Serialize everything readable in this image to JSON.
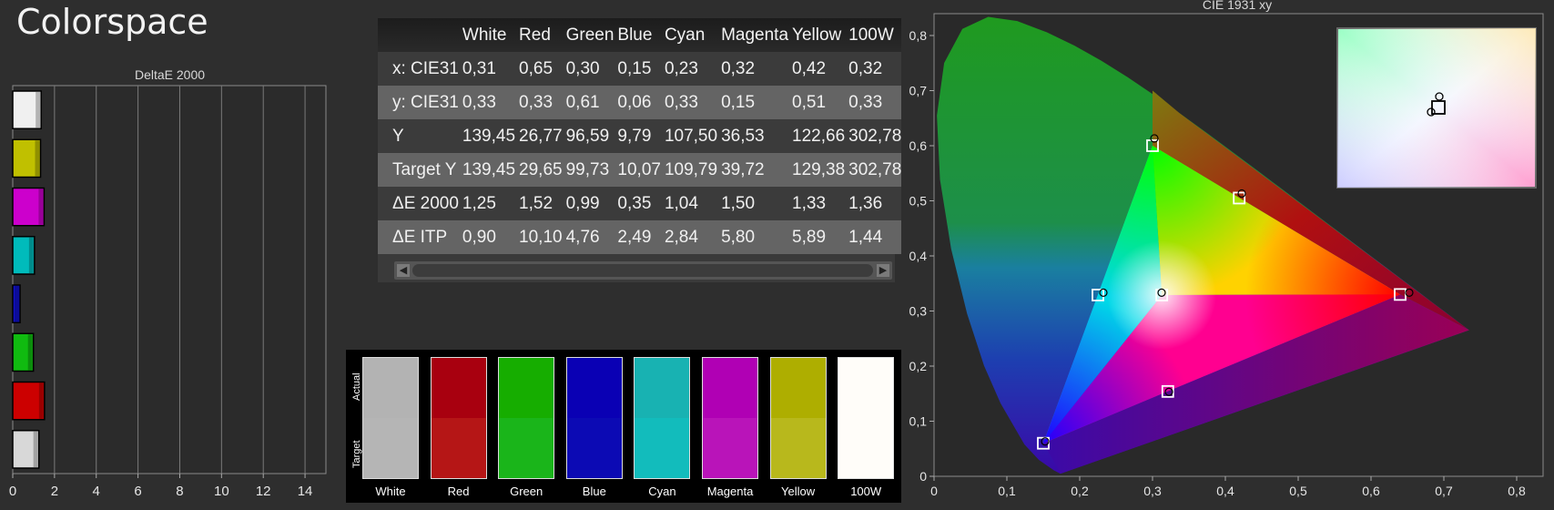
{
  "page": {
    "title": "Colorspace"
  },
  "delta_chart": {
    "title": "DeltaE 2000",
    "x_ticks": [
      "0",
      "2",
      "4",
      "6",
      "8",
      "10",
      "12",
      "14"
    ],
    "bars": [
      {
        "name": "White",
        "value": 1.36,
        "color": "#f0f0f0"
      },
      {
        "name": "Yellow",
        "value": 1.33,
        "color": "#c0c000"
      },
      {
        "name": "Magenta",
        "value": 1.5,
        "color": "#cc00cc"
      },
      {
        "name": "Cyan",
        "value": 1.04,
        "color": "#00bbbb"
      },
      {
        "name": "Blue",
        "value": 0.35,
        "color": "#1010cc"
      },
      {
        "name": "Green",
        "value": 0.99,
        "color": "#10bb10"
      },
      {
        "name": "Red",
        "value": 1.52,
        "color": "#cc0000"
      },
      {
        "name": "White",
        "value": 1.25,
        "color": "#d8d8d8"
      }
    ]
  },
  "table": {
    "headers": [
      "",
      "White",
      "Red",
      "Green",
      "Blue",
      "Cyan",
      "Magenta",
      "Yellow",
      "100W"
    ],
    "rows": [
      {
        "label": "x: CIE31",
        "values": [
          "0,31",
          "0,65",
          "0,30",
          "0,15",
          "0,23",
          "0,32",
          "0,42",
          "0,32"
        ]
      },
      {
        "label": "y: CIE31",
        "values": [
          "0,33",
          "0,33",
          "0,61",
          "0,06",
          "0,33",
          "0,15",
          "0,51",
          "0,33"
        ]
      },
      {
        "label": "Y",
        "values": [
          "139,45",
          "26,77",
          "96,59",
          "9,79",
          "107,50",
          "36,53",
          "122,66",
          "302,78"
        ]
      },
      {
        "label": "Target Y",
        "values": [
          "139,45",
          "29,65",
          "99,73",
          "10,07",
          "109,79",
          "39,72",
          "129,38",
          "302,78"
        ]
      },
      {
        "label": "ΔE 2000",
        "values": [
          "1,25",
          "1,52",
          "0,99",
          "0,35",
          "1,04",
          "1,50",
          "1,33",
          "1,36"
        ]
      },
      {
        "label": "ΔE ITP",
        "values": [
          "0,90",
          "10,10",
          "4,76",
          "2,49",
          "2,84",
          "5,80",
          "5,89",
          "1,44"
        ]
      }
    ],
    "scroll_left": "◀",
    "scroll_right": "▶"
  },
  "swatches": {
    "actual_label": "Actual",
    "target_label": "Target",
    "items": [
      {
        "name": "White",
        "actual": "#b3b3b3",
        "target": "#b5b5b5"
      },
      {
        "name": "Red",
        "actual": "#a8000f",
        "target": "#b51616"
      },
      {
        "name": "Green",
        "actual": "#16ad00",
        "target": "#1ab51a"
      },
      {
        "name": "Blue",
        "actual": "#0a00b4",
        "target": "#0c0ab4"
      },
      {
        "name": "Cyan",
        "actual": "#18b2b2",
        "target": "#12bcbc"
      },
      {
        "name": "Magenta",
        "actual": "#b000b4",
        "target": "#b914b9"
      },
      {
        "name": "Yellow",
        "actual": "#aeae00",
        "target": "#b8b81c"
      },
      {
        "name": "100W",
        "actual": "#fffdf9",
        "target": "#fffdf9"
      }
    ]
  },
  "cie": {
    "title": "CIE 1931 xy",
    "x_ticks": [
      "0",
      "0,1",
      "0,2",
      "0,3",
      "0,4",
      "0,5",
      "0,6",
      "0,7",
      "0,8"
    ],
    "y_ticks": [
      "0",
      "0,1",
      "0,2",
      "0,3",
      "0,4",
      "0,5",
      "0,6",
      "0,7",
      "0,8"
    ],
    "targets": [
      {
        "name": "White",
        "x": 0.3127,
        "y": 0.329
      },
      {
        "name": "Red",
        "x": 0.64,
        "y": 0.33
      },
      {
        "name": "Green",
        "x": 0.3,
        "y": 0.6
      },
      {
        "name": "Blue",
        "x": 0.15,
        "y": 0.06
      },
      {
        "name": "Cyan",
        "x": 0.225,
        "y": 0.329
      },
      {
        "name": "Magenta",
        "x": 0.321,
        "y": 0.154
      },
      {
        "name": "Yellow",
        "x": 0.419,
        "y": 0.505
      }
    ],
    "measured": [
      {
        "name": "White",
        "x": 0.31,
        "y": 0.33
      },
      {
        "name": "Red",
        "x": 0.65,
        "y": 0.33
      },
      {
        "name": "Green",
        "x": 0.3,
        "y": 0.61
      },
      {
        "name": "Blue",
        "x": 0.15,
        "y": 0.06
      },
      {
        "name": "Cyan",
        "x": 0.23,
        "y": 0.33
      },
      {
        "name": "Magenta",
        "x": 0.32,
        "y": 0.15
      },
      {
        "name": "Yellow",
        "x": 0.42,
        "y": 0.51
      }
    ]
  }
}
